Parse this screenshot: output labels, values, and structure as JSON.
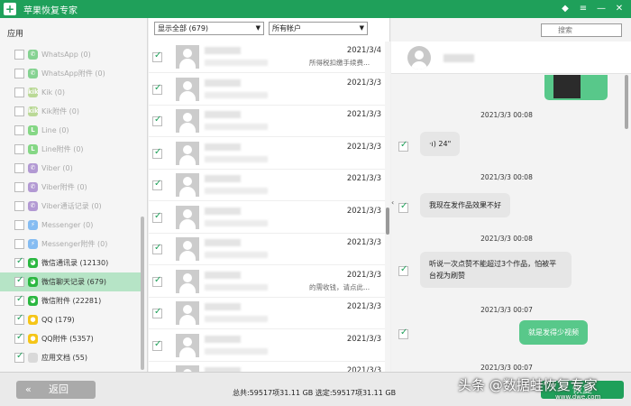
{
  "window": {
    "title": "苹果恢复专家",
    "logo_glyph": "+",
    "controls": [
      "◆",
      "≡",
      "—",
      "✕"
    ]
  },
  "sidebar": {
    "section_title": "应用",
    "items": [
      {
        "label": "WhatsApp (0)",
        "icon": "whatsapp-icon",
        "icon_color": "#2bb741",
        "glyph": "✆",
        "checked": false,
        "enabled": false
      },
      {
        "label": "WhatsApp附件 (0)",
        "icon": "whatsapp-icon",
        "icon_color": "#2bb741",
        "glyph": "✆",
        "checked": false,
        "enabled": false
      },
      {
        "label": "Kik (0)",
        "icon": "kik-icon",
        "icon_color": "#8bc34a",
        "glyph": "kik",
        "checked": false,
        "enabled": false
      },
      {
        "label": "Kik附件 (0)",
        "icon": "kik-icon",
        "icon_color": "#8bc34a",
        "glyph": "kik",
        "checked": false,
        "enabled": false
      },
      {
        "label": "Line (0)",
        "icon": "line-icon",
        "icon_color": "#2bbf2b",
        "glyph": "L",
        "checked": false,
        "enabled": false
      },
      {
        "label": "Line附件 (0)",
        "icon": "line-icon",
        "icon_color": "#2bbf2b",
        "glyph": "L",
        "checked": false,
        "enabled": false
      },
      {
        "label": "Viber (0)",
        "icon": "viber-icon",
        "icon_color": "#7d4fb8",
        "glyph": "✆",
        "checked": false,
        "enabled": false
      },
      {
        "label": "Viber附件 (0)",
        "icon": "viber-icon",
        "icon_color": "#7d4fb8",
        "glyph": "✆",
        "checked": false,
        "enabled": false
      },
      {
        "label": "Viber通话记录 (0)",
        "icon": "viber-icon",
        "icon_color": "#7d4fb8",
        "glyph": "✆",
        "checked": false,
        "enabled": false
      },
      {
        "label": "Messenger (0)",
        "icon": "messenger-icon",
        "icon_color": "#2b8ef0",
        "glyph": "⚡",
        "checked": false,
        "enabled": false
      },
      {
        "label": "Messenger附件 (0)",
        "icon": "messenger-icon",
        "icon_color": "#2b8ef0",
        "glyph": "⚡",
        "checked": false,
        "enabled": false
      },
      {
        "label": "微信通讯录 (12130)",
        "icon": "wechat-icon",
        "icon_color": "#2bb741",
        "glyph": "◕",
        "checked": true,
        "enabled": true
      },
      {
        "label": "微信聊天记录 (679)",
        "icon": "wechat-icon",
        "icon_color": "#2bb741",
        "glyph": "◕",
        "checked": true,
        "enabled": true,
        "selected": true
      },
      {
        "label": "微信附件 (22281)",
        "icon": "wechat-icon",
        "icon_color": "#2bb741",
        "glyph": "◕",
        "checked": true,
        "enabled": true
      },
      {
        "label": "QQ (179)",
        "icon": "qq-icon",
        "icon_color": "#f5c518",
        "glyph": "●",
        "checked": true,
        "enabled": true
      },
      {
        "label": "QQ附件 (5357)",
        "icon": "qq-icon",
        "icon_color": "#f5c518",
        "glyph": "●",
        "checked": true,
        "enabled": true
      },
      {
        "label": "应用文档 (55)",
        "icon": "document-icon",
        "icon_color": "#d9d9d9",
        "glyph": "",
        "checked": true,
        "enabled": true
      }
    ]
  },
  "list": {
    "filter_select": "显示全部 (679)",
    "account_select": "所有帐户",
    "rows": [
      {
        "date": "2021/3/4",
        "preview": "所得税扣缴手续费..."
      },
      {
        "date": "2021/3/3",
        "preview": ""
      },
      {
        "date": "2021/3/3",
        "preview": ""
      },
      {
        "date": "2021/3/3",
        "preview": ""
      },
      {
        "date": "2021/3/3",
        "preview": ""
      },
      {
        "date": "2021/3/3",
        "preview": ""
      },
      {
        "date": "2021/3/3",
        "preview": ""
      },
      {
        "date": "2021/3/3",
        "preview": "的需收钱，请点此..."
      },
      {
        "date": "2021/3/3",
        "preview": ""
      },
      {
        "date": "2021/3/3",
        "preview": ""
      },
      {
        "date": "2021/3/3",
        "preview": ""
      }
    ]
  },
  "search": {
    "placeholder": "搜索"
  },
  "chat": {
    "messages": [
      {
        "timestamp": "2021/3/3 00:08"
      },
      {
        "timestamp": "2021/3/3 00:08",
        "direction": "in",
        "text": "·ı)  24\""
      },
      {
        "timestamp": "2021/3/3 00:08",
        "direction": "in",
        "text": "我现在发作品效果不好"
      },
      {
        "timestamp": "2021/3/3 00:07",
        "direction": "in",
        "text": "听说一次点赞不能超过3个作品，怕被平台视为刷赞"
      },
      {
        "timestamp": "2021/3/3 00:07",
        "direction": "out",
        "text": "就是发得少视频"
      },
      {
        "timestamp": "2021/3/3 00:05"
      }
    ]
  },
  "footer": {
    "back_label": "返回",
    "back_glyph": "«",
    "stats": "总共:59517项31.11 GB 选定:59517项31.11 GB",
    "recover_label": "恢复"
  },
  "watermark": {
    "text": "头条 @数据蛙恢复专家",
    "site": "www.dwe.com"
  }
}
